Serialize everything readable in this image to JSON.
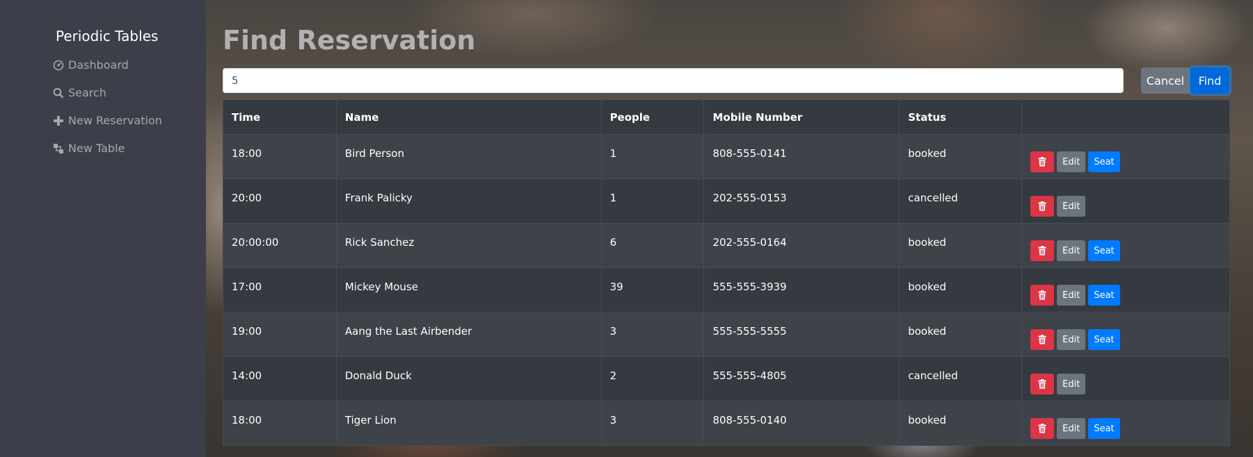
{
  "sidebar": {
    "brand": "Periodic Tables",
    "items": [
      {
        "label": "Dashboard",
        "icon": "dashboard-icon"
      },
      {
        "label": "Search",
        "icon": "search-icon"
      },
      {
        "label": "New Reservation",
        "icon": "plus-icon"
      },
      {
        "label": "New Table",
        "icon": "table-icon"
      }
    ]
  },
  "main": {
    "title": "Find Reservation",
    "search": {
      "value": "5",
      "placeholder": ""
    },
    "cancel_label": "Cancel",
    "find_label": "Find"
  },
  "table": {
    "headers": [
      "Time",
      "Name",
      "People",
      "Mobile Number",
      "Status",
      ""
    ],
    "edit_label": "Edit",
    "seat_label": "Seat",
    "rows": [
      {
        "time": "18:00",
        "name": "Bird Person",
        "people": "1",
        "mobile": "808-555-0141",
        "status": "booked"
      },
      {
        "time": "20:00",
        "name": "Frank Palicky",
        "people": "1",
        "mobile": "202-555-0153",
        "status": "cancelled"
      },
      {
        "time": "20:00:00",
        "name": "Rick Sanchez",
        "people": "6",
        "mobile": "202-555-0164",
        "status": "booked"
      },
      {
        "time": "17:00",
        "name": "Mickey Mouse",
        "people": "39",
        "mobile": "555-555-3939",
        "status": "booked"
      },
      {
        "time": "19:00",
        "name": "Aang the Last Airbender",
        "people": "3",
        "mobile": "555-555-5555",
        "status": "booked"
      },
      {
        "time": "14:00",
        "name": "Donald Duck",
        "people": "2",
        "mobile": "555-555-4805",
        "status": "cancelled"
      },
      {
        "time": "18:00",
        "name": "Tiger Lion",
        "people": "3",
        "mobile": "808-555-0140",
        "status": "booked"
      }
    ]
  },
  "colors": {
    "sidebar_bg": "#3c3f49",
    "delete": "#dc3545",
    "edit": "#6c757d",
    "seat": "#007bff",
    "find": "#0069d9"
  }
}
